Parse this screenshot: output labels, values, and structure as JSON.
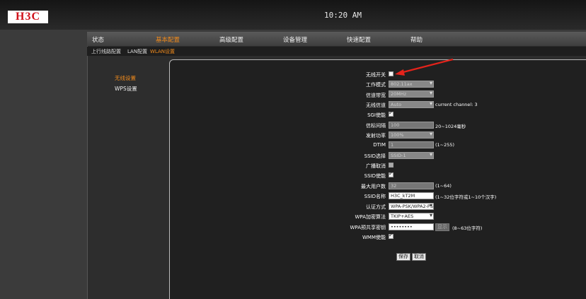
{
  "header": {
    "logo": "H3C",
    "time": "10:20 AM"
  },
  "nav": [
    "状态",
    "基本配置",
    "高级配置",
    "设备管理",
    "快速配置",
    "帮助"
  ],
  "subnav": [
    "上行线路配置",
    "LAN配置",
    "WLAN设置"
  ],
  "sidebar": [
    "无线设置",
    "WPS设置"
  ],
  "form": {
    "wireless_switch": "无线开关",
    "work_mode": {
      "label": "工作模式",
      "value": "802.11ax"
    },
    "bandwidth": {
      "label": "信道带宽",
      "value": "20MHz"
    },
    "channel": {
      "label": "无线信道",
      "value": "Auto",
      "note": "current channel: 3"
    },
    "sgi": "SGI使能",
    "beacon": {
      "label": "信标间隔",
      "value": "100",
      "note": "20~1024毫秒"
    },
    "power": {
      "label": "发射功率",
      "value": "100%"
    },
    "dtim": {
      "label": "DTIM",
      "value": "1",
      "note": "(1~255)"
    },
    "ssid_select": {
      "label": "SSID选择",
      "value": "SSID-1"
    },
    "broadcast_cancel": "广播取消",
    "ssid_enable": "SSID使能",
    "max_users": {
      "label": "最大用户数",
      "value": "32",
      "note": "(1~64)"
    },
    "ssid_name": {
      "label": "SSID名称",
      "value": "H3C_kT2M",
      "note": "(1~32位字符或1~10个汉字)"
    },
    "auth": {
      "label": "认证方式",
      "value": "WPA-PSK/WPA2-PSK"
    },
    "encrypt": {
      "label": "WPA加密算法",
      "value": "TKIP+AES"
    },
    "psk": {
      "label": "WPA预共享密钥",
      "value": "••••••••",
      "show_label": "显示",
      "note": "(8~63位字符)"
    },
    "wmm": "WMM使能",
    "save": "保存",
    "cancel": "取消"
  }
}
